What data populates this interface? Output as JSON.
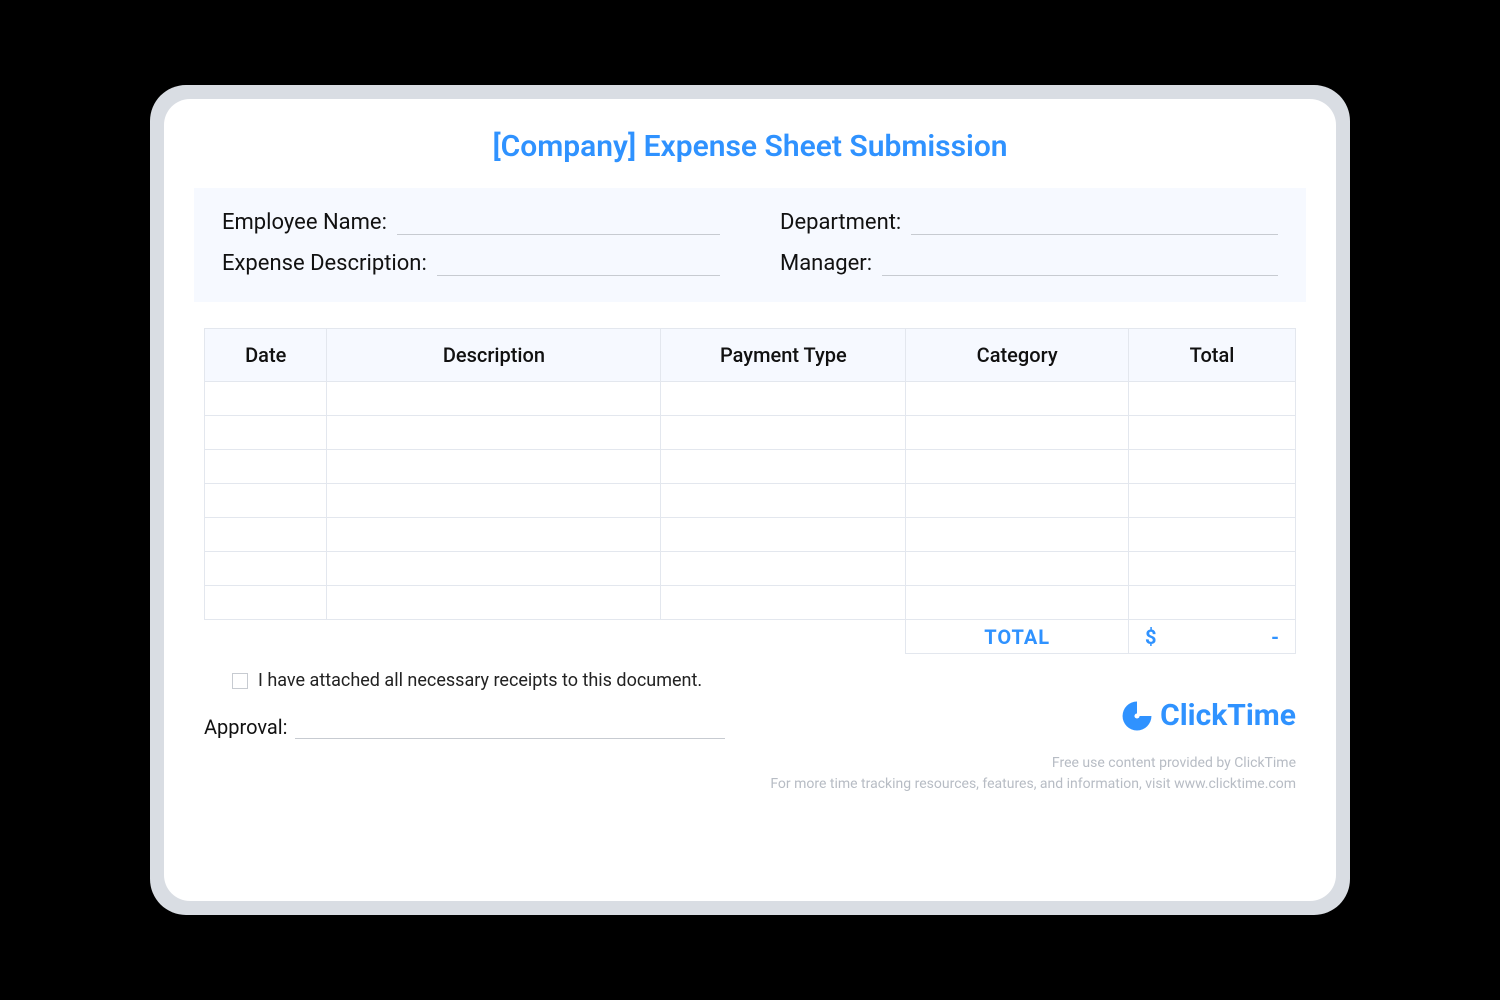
{
  "title": "[Company] Expense Sheet Submission",
  "info": {
    "employee_name_label": "Employee Name:",
    "department_label": "Department:",
    "expense_desc_label": "Expense Description:",
    "manager_label": "Manager:"
  },
  "columns": {
    "date": "Date",
    "description": "Description",
    "payment_type": "Payment Type",
    "category": "Category",
    "total": "Total"
  },
  "total_row": {
    "label": "TOTAL",
    "currency": "$",
    "value": "-"
  },
  "receipt_check": "I have attached all necessary receipts to this document.",
  "approval_label": "Approval:",
  "brand": "ClickTime",
  "footer": {
    "line1": "Free use content provided by ClickTime",
    "line2": "For more time tracking resources, features, and information, visit www.clicktime.com"
  }
}
